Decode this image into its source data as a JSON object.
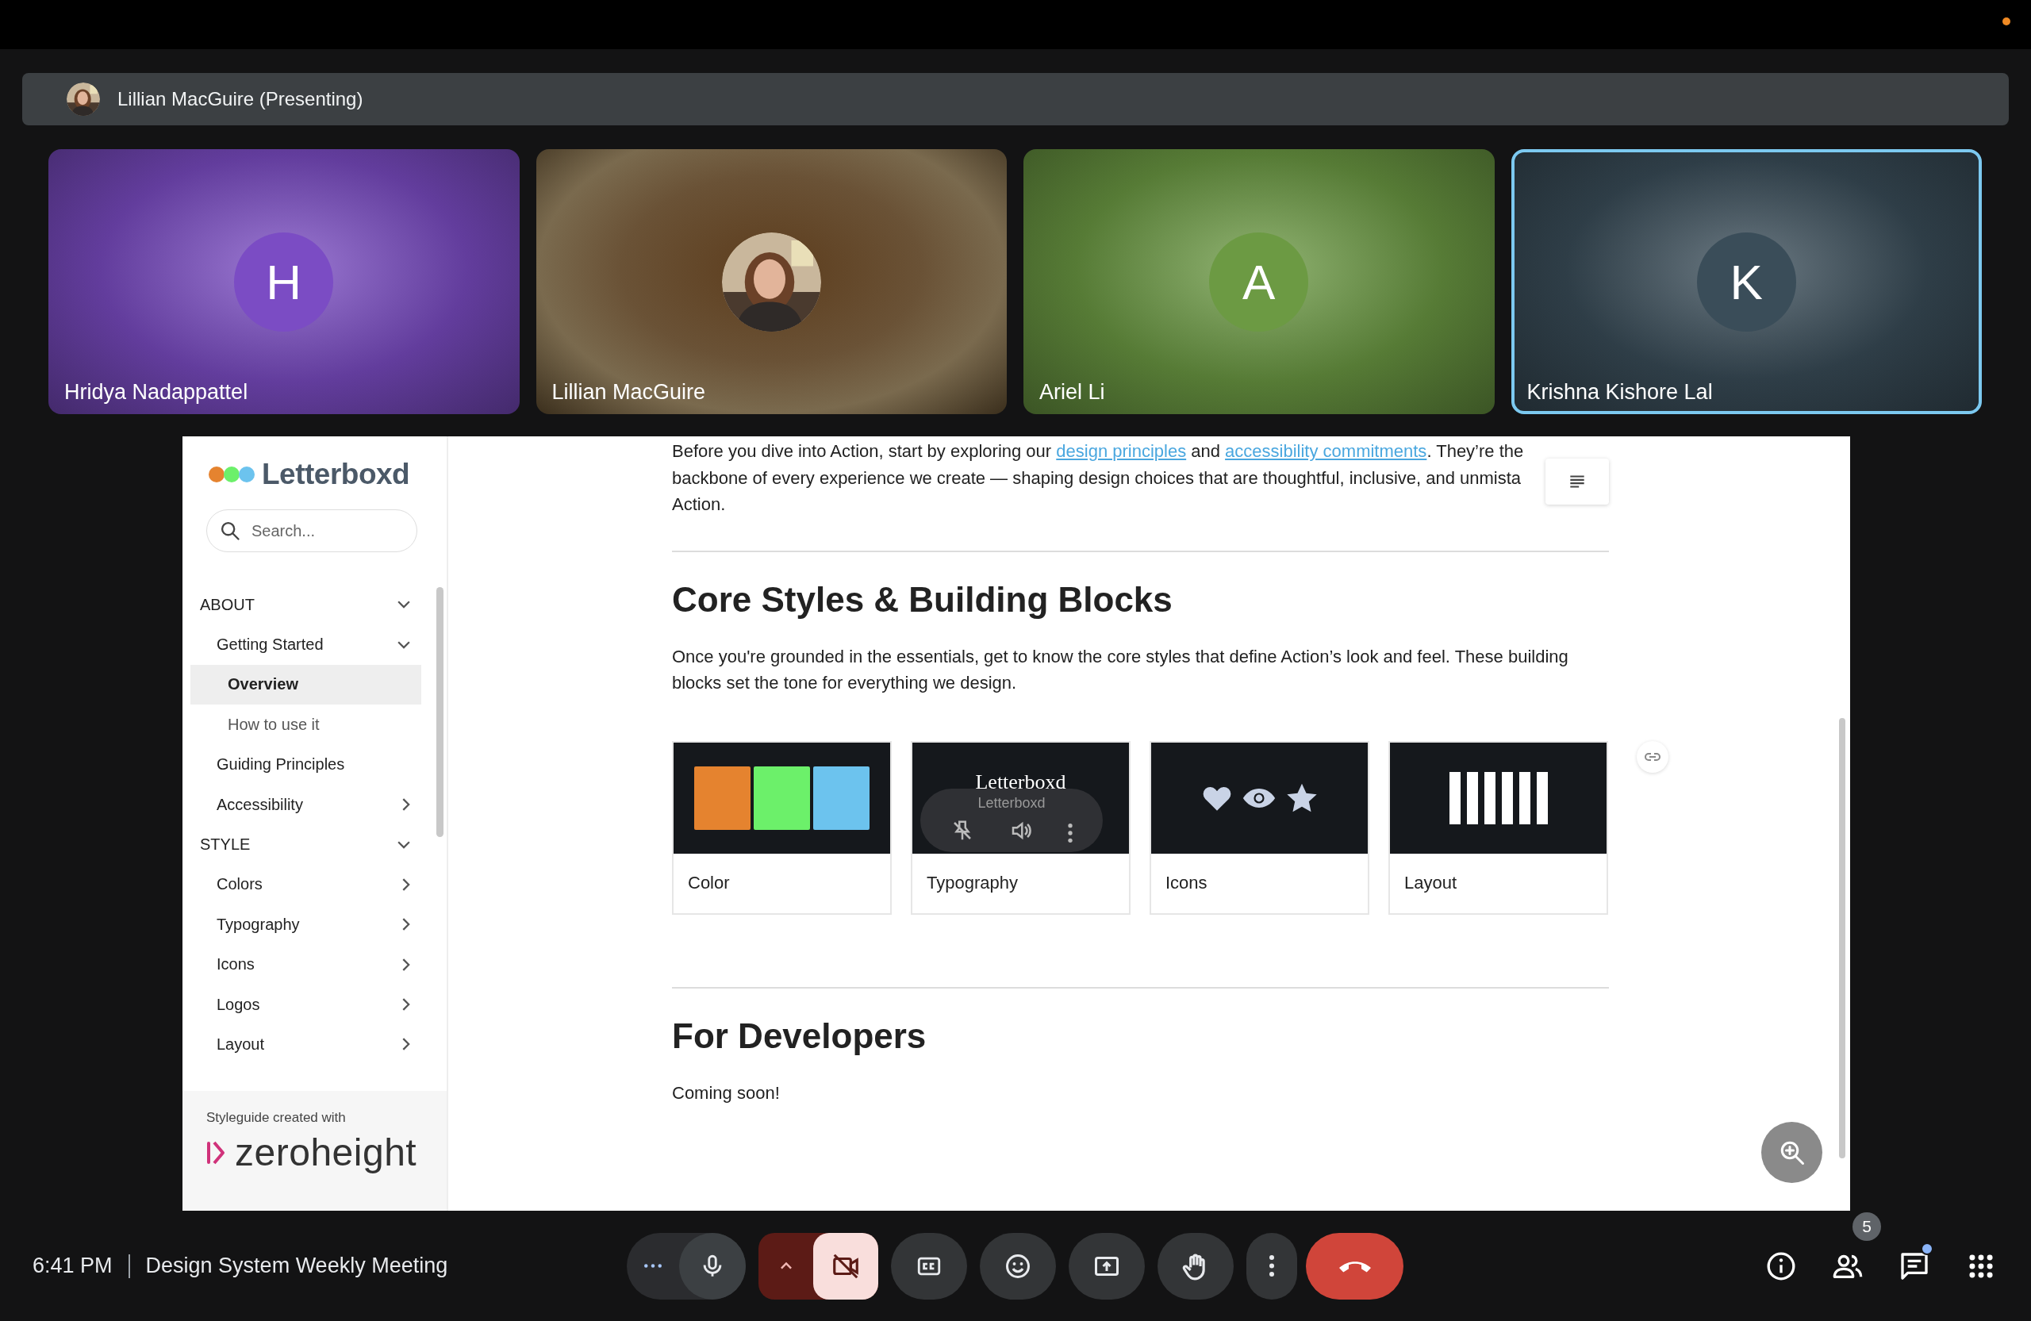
{
  "presenter_bar": {
    "label": "Lillian MacGuire (Presenting)"
  },
  "tiles": [
    {
      "name": "Hridya Nadappattel",
      "kind": "initial",
      "initial": "H",
      "color": "#7b4cc4",
      "speaking": false
    },
    {
      "name": "Lillian MacGuire",
      "speaking": false
    },
    {
      "name": "Ariel Li",
      "kind": "initial",
      "initial": "A",
      "color": "#6c9a43",
      "speaking": false
    },
    {
      "name": "Krishna Kishore Lal",
      "kind": "initial",
      "initial": "K",
      "color": "#3a4d59",
      "speaking": true
    }
  ],
  "shared_screen": {
    "sidebar": {
      "logo": "Letterboxd",
      "search": {
        "placeholder": "Search..."
      },
      "nav": [
        {
          "label": "ABOUT",
          "expanded": true,
          "selected": false,
          "children": [
            {
              "label": "Getting Started",
              "expanded": true,
              "selected": false,
              "children": [
                {
                  "label": "Overview",
                  "selected": true
                },
                {
                  "label": "How to use it",
                  "selected": false
                }
              ]
            },
            {
              "label": "Guiding Principles",
              "selected": false
            },
            {
              "label": "Accessibility",
              "expanded": false,
              "selected": false
            }
          ]
        },
        {
          "label": "STYLE",
          "expanded": true,
          "selected": false,
          "children": [
            {
              "label": "Colors",
              "expanded": false,
              "selected": false
            },
            {
              "label": "Typography",
              "expanded": false,
              "selected": false
            },
            {
              "label": "Icons",
              "expanded": false,
              "selected": false
            },
            {
              "label": "Logos",
              "expanded": false,
              "selected": false
            },
            {
              "label": "Layout",
              "expanded": false,
              "selected": false
            }
          ]
        }
      ],
      "footer": {
        "caption": "Styleguide created with",
        "brand": "zeroheight"
      }
    },
    "content": {
      "intro_lines": [
        [
          {
            "kind": "text",
            "text": "Before you dive into Action, start by exploring our "
          },
          {
            "kind": "link",
            "text": "design principles"
          },
          {
            "kind": "text",
            "text": " and "
          },
          {
            "kind": "link",
            "text": "accessibility commitments"
          },
          {
            "kind": "text",
            "text": ". They’re the"
          }
        ],
        [
          {
            "kind": "text",
            "text": "backbone of every experience we create — shaping design choices that are thoughtful, inclusive, and unmista"
          }
        ],
        [
          {
            "kind": "text",
            "text": "Action."
          }
        ]
      ],
      "sections": [
        {
          "heading": "Core Styles & Building Blocks",
          "body": "Once you're grounded in the essentials, get to know the core styles that define Action’s look and feel. These building blocks set the tone for everything we design.",
          "cards": [
            {
              "label": "Color",
              "kind": "swatches",
              "swatches": [
                {
                  "color": "#e5832f"
                },
                {
                  "color": "#6cf06a"
                },
                {
                  "color": "#6cc3ee"
                }
              ]
            },
            {
              "label": "Typography",
              "kind": "type",
              "sample": "Letterboxd",
              "overlay": {
                "caption": "Letterboxd"
              }
            },
            {
              "label": "Icons",
              "kind": "icons"
            },
            {
              "label": "Layout",
              "kind": "columns"
            }
          ]
        },
        {
          "heading": "For Developers",
          "body": "Coming soon!"
        }
      ]
    }
  },
  "meeting": {
    "time": "6:41 PM",
    "title": "Design System Weekly Meeting"
  },
  "control_groups": [
    [
      {
        "kind": "more"
      },
      {
        "kind": "mic",
        "on": true
      }
    ],
    [
      {
        "kind": "camera_menu"
      },
      {
        "kind": "camera",
        "on": false
      }
    ],
    [
      {
        "kind": "captions",
        "on": false
      }
    ],
    [
      {
        "kind": "reactions"
      }
    ],
    [
      {
        "kind": "present"
      }
    ],
    [
      {
        "kind": "hand",
        "on": false
      }
    ],
    [
      {
        "kind": "menu"
      }
    ],
    [
      {
        "kind": "leave"
      }
    ]
  ],
  "side_controls": [
    {
      "kind": "info"
    },
    {
      "kind": "people",
      "badge": "5"
    },
    {
      "kind": "chat",
      "unread": true
    },
    {
      "kind": "activities"
    }
  ]
}
